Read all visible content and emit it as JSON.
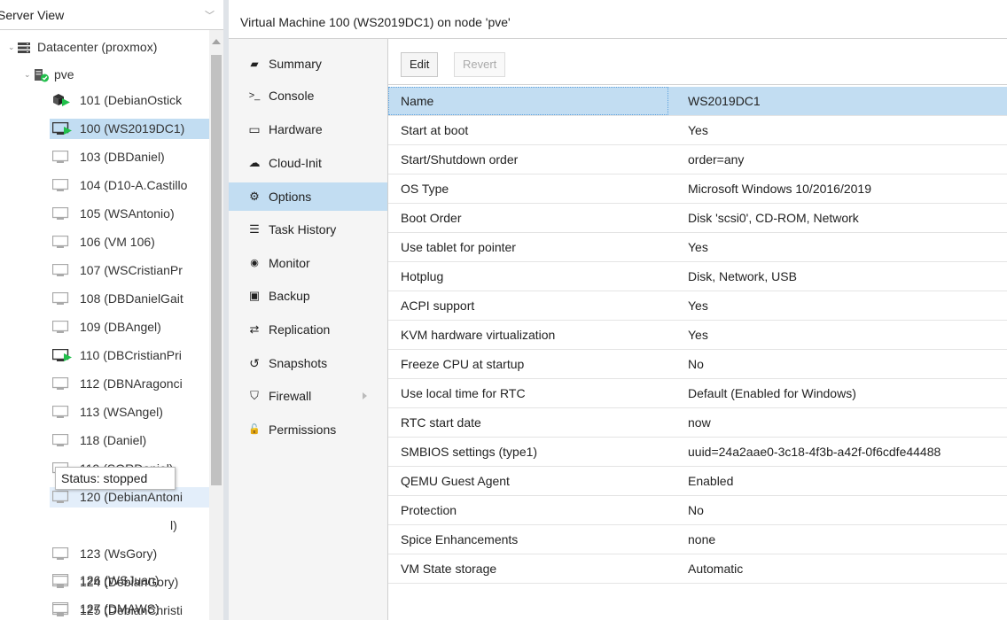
{
  "tree": {
    "view_title": "Server View",
    "datacenter": "Datacenter (proxmox)",
    "node": "pve",
    "vms": [
      {
        "label": "101 (DebianOstick",
        "state": "running-template",
        "selected": false
      },
      {
        "label": "100 (WS2019DC1)",
        "state": "running",
        "selected": true
      },
      {
        "label": "103 (DBDaniel)",
        "state": "stopped",
        "selected": false
      },
      {
        "label": "104 (D10-A.Castillo",
        "state": "stopped",
        "selected": false
      },
      {
        "label": "105 (WSAntonio)",
        "state": "stopped",
        "selected": false
      },
      {
        "label": "106 (VM 106)",
        "state": "stopped",
        "selected": false
      },
      {
        "label": "107 (WSCristianPr",
        "state": "stopped",
        "selected": false
      },
      {
        "label": "108 (DBDanielGait",
        "state": "stopped",
        "selected": false
      },
      {
        "label": "109 (DBAngel)",
        "state": "stopped",
        "selected": false
      },
      {
        "label": "110 (DBCristianPri",
        "state": "running",
        "selected": false
      },
      {
        "label": "112 (DBNAragonci",
        "state": "stopped",
        "selected": false
      },
      {
        "label": "113 (WSAngel)",
        "state": "stopped",
        "selected": false
      },
      {
        "label": "118 (Daniel)",
        "state": "stopped",
        "selected": false
      },
      {
        "label": "119 (SORDaniel)",
        "state": "stopped",
        "selected": false
      },
      {
        "label": "120 (DebianAntoni",
        "state": "stopped",
        "selected": false,
        "hover": true
      },
      {
        "label": "l)",
        "state": "hidden",
        "selected": false
      },
      {
        "label": "123 (WsGory)",
        "state": "stopped",
        "selected": false
      },
      {
        "label": "124 (DebianGory)",
        "state": "stopped",
        "selected": false
      },
      {
        "label": "125 (DebianChristi",
        "state": "stopped",
        "selected": false
      },
      {
        "label": "126 (WSJuan)",
        "state": "stopped",
        "selected": false
      },
      {
        "label": "127 (DMAWS)",
        "state": "stopped",
        "selected": false
      }
    ],
    "tooltip": "Status: stopped"
  },
  "content": {
    "title": "Virtual Machine 100 (WS2019DC1) on node 'pve'",
    "nav": [
      {
        "icon": "book-icon",
        "glyph": "▰",
        "label": "Summary",
        "active": false
      },
      {
        "icon": "terminal-icon",
        "glyph": ">_",
        "label": "Console",
        "active": false
      },
      {
        "icon": "desktop-icon",
        "glyph": "▭",
        "label": "Hardware",
        "active": false
      },
      {
        "icon": "cloud-icon",
        "glyph": "☁",
        "label": "Cloud-Init",
        "active": false
      },
      {
        "icon": "gear-icon",
        "glyph": "⚙",
        "label": "Options",
        "active": true
      },
      {
        "icon": "list-icon",
        "glyph": "☰",
        "label": "Task History",
        "active": false
      },
      {
        "icon": "eye-icon",
        "glyph": "◉",
        "label": "Monitor",
        "active": false
      },
      {
        "icon": "floppy-icon",
        "glyph": "▣",
        "label": "Backup",
        "active": false
      },
      {
        "icon": "retweet-icon",
        "glyph": "⇄",
        "label": "Replication",
        "active": false
      },
      {
        "icon": "history-icon",
        "glyph": "↺",
        "label": "Snapshots",
        "active": false
      },
      {
        "icon": "shield-icon",
        "glyph": "⛉",
        "label": "Firewall",
        "active": false,
        "submenu": true
      },
      {
        "icon": "unlock-icon",
        "glyph": "🔓",
        "label": "Permissions",
        "active": false
      }
    ],
    "toolbar": {
      "edit_label": "Edit",
      "revert_label": "Revert"
    },
    "options": [
      {
        "key": "Name",
        "value": "WS2019DC1",
        "selected": true
      },
      {
        "key": "Start at boot",
        "value": "Yes"
      },
      {
        "key": "Start/Shutdown order",
        "value": "order=any"
      },
      {
        "key": "OS Type",
        "value": "Microsoft Windows 10/2016/2019"
      },
      {
        "key": "Boot Order",
        "value": "Disk 'scsi0', CD-ROM, Network"
      },
      {
        "key": "Use tablet for pointer",
        "value": "Yes"
      },
      {
        "key": "Hotplug",
        "value": "Disk, Network, USB"
      },
      {
        "key": "ACPI support",
        "value": "Yes"
      },
      {
        "key": "KVM hardware virtualization",
        "value": "Yes"
      },
      {
        "key": "Freeze CPU at startup",
        "value": "No"
      },
      {
        "key": "Use local time for RTC",
        "value": "Default (Enabled for Windows)"
      },
      {
        "key": "RTC start date",
        "value": "now"
      },
      {
        "key": "SMBIOS settings (type1)",
        "value": "uuid=24a2aae0-3c18-4f3b-a42f-0f6cdfe44488"
      },
      {
        "key": "QEMU Guest Agent",
        "value": "Enabled"
      },
      {
        "key": "Protection",
        "value": "No"
      },
      {
        "key": "Spice Enhancements",
        "value": "none"
      },
      {
        "key": "VM State storage",
        "value": "Automatic"
      }
    ]
  },
  "colors": {
    "selection": "#c2ddf2",
    "running": "#21bf4b",
    "nav_bg": "#f5f5f5"
  }
}
